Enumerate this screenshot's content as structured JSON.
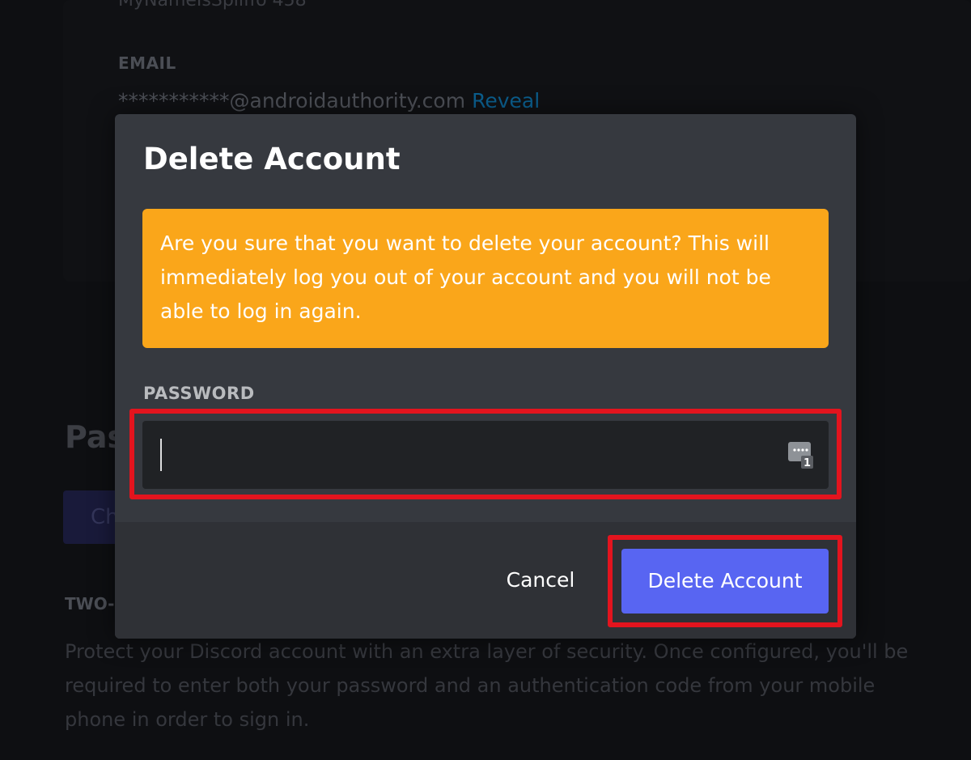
{
  "background": {
    "username_partial": "MyNameIsSpliffo 458",
    "email_label": "EMAIL",
    "email_value": "***********@androidauthority.com",
    "reveal_link": "Reveal",
    "password_heading_partial": "Pas",
    "change_button_partial": "Ch",
    "twofa_label_partial": "TWO-",
    "twofa_description": "Protect your Discord account with an extra layer of security. Once configured, you'll be required to enter both your password and an authentication code from your mobile phone in order to sign in."
  },
  "modal": {
    "title": "Delete Account",
    "warning": "Are you sure that you want to delete your account? This will immediately log you out of your account and you will not be able to log in again.",
    "password_label": "PASSWORD",
    "password_value": "",
    "cancel_label": "Cancel",
    "delete_label": "Delete Account"
  },
  "colors": {
    "modal_bg": "#36393f",
    "footer_bg": "#2f3136",
    "warning_bg": "#faa61a",
    "input_bg": "#202225",
    "primary_button": "#5865f2",
    "highlight": "#e3141e",
    "link": "#00aff4"
  },
  "icons": {
    "password_manager": "password-manager-icon"
  }
}
